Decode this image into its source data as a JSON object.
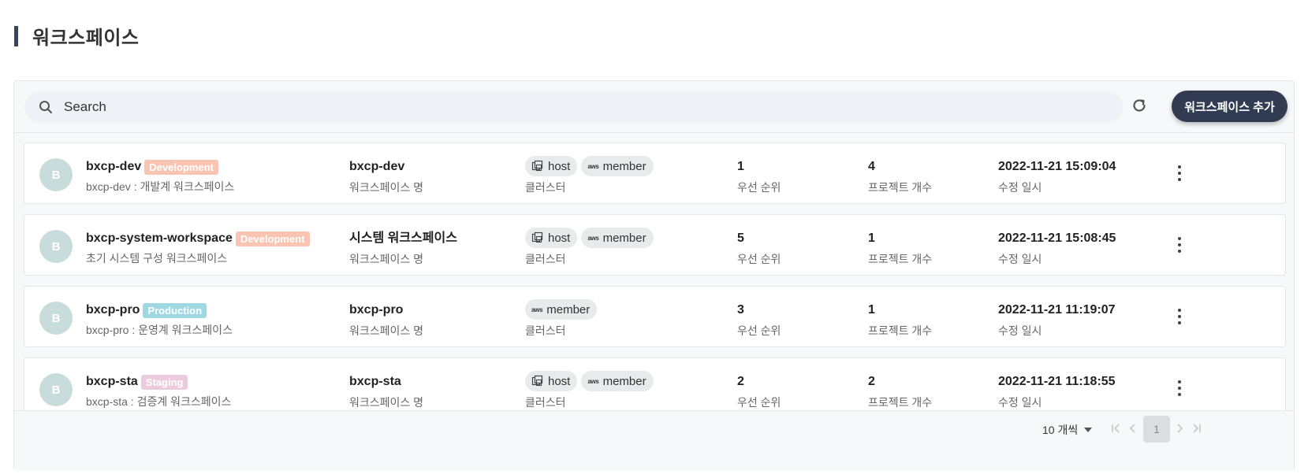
{
  "page": {
    "title": "워크스페이스"
  },
  "toolbar": {
    "search_placeholder": "Search",
    "add_button_label": "워크스페이스 추가"
  },
  "colors": {
    "Development": "#f9c5b2",
    "Production": "#9ed9e3",
    "Staging": "#eccbdf",
    "primary_button": "#313c52",
    "avatar": "#c9dcdc"
  },
  "workspaces": [
    {
      "avatar": "B",
      "name": "bxcp-dev",
      "env": "Development",
      "description": "bxcp-dev : 개발계 워크스페이스",
      "display_name": "bxcp-dev",
      "display_name_label": "워크스페이스 명",
      "clusters": [
        {
          "name": "host",
          "icon": "cluster-icon"
        },
        {
          "name": "member",
          "icon": "aws-icon"
        }
      ],
      "cluster_label": "클러스터",
      "priority": "1",
      "priority_label": "우선 순위",
      "project_count": "4",
      "project_count_label": "프로젝트 개수",
      "modified": "2022-11-21 15:09:04",
      "modified_label": "수정 일시"
    },
    {
      "avatar": "B",
      "name": "bxcp-system-workspace",
      "env": "Development",
      "description": "초기 시스템 구성 워크스페이스",
      "display_name": "시스템 워크스페이스",
      "display_name_label": "워크스페이스 명",
      "clusters": [
        {
          "name": "host",
          "icon": "cluster-icon"
        },
        {
          "name": "member",
          "icon": "aws-icon"
        }
      ],
      "cluster_label": "클러스터",
      "priority": "5",
      "priority_label": "우선 순위",
      "project_count": "1",
      "project_count_label": "프로젝트 개수",
      "modified": "2022-11-21 15:08:45",
      "modified_label": "수정 일시"
    },
    {
      "avatar": "B",
      "name": "bxcp-pro",
      "env": "Production",
      "description": "bxcp-pro : 운영계 워크스페이스",
      "display_name": "bxcp-pro",
      "display_name_label": "워크스페이스 명",
      "clusters": [
        {
          "name": "member",
          "icon": "aws-icon"
        }
      ],
      "cluster_label": "클러스터",
      "priority": "3",
      "priority_label": "우선 순위",
      "project_count": "1",
      "project_count_label": "프로젝트 개수",
      "modified": "2022-11-21 11:19:07",
      "modified_label": "수정 일시"
    },
    {
      "avatar": "B",
      "name": "bxcp-sta",
      "env": "Staging",
      "description": "bxcp-sta : 검증계 워크스페이스",
      "display_name": "bxcp-sta",
      "display_name_label": "워크스페이스 명",
      "clusters": [
        {
          "name": "host",
          "icon": "cluster-icon"
        },
        {
          "name": "member",
          "icon": "aws-icon"
        }
      ],
      "cluster_label": "클러스터",
      "priority": "2",
      "priority_label": "우선 순위",
      "project_count": "2",
      "project_count_label": "프로젝트 개수",
      "modified": "2022-11-21 11:18:55",
      "modified_label": "수정 일시"
    }
  ],
  "pagination": {
    "page_size_label": "10 개씩",
    "current_page": "1",
    "aws_icon_text": "aws"
  }
}
